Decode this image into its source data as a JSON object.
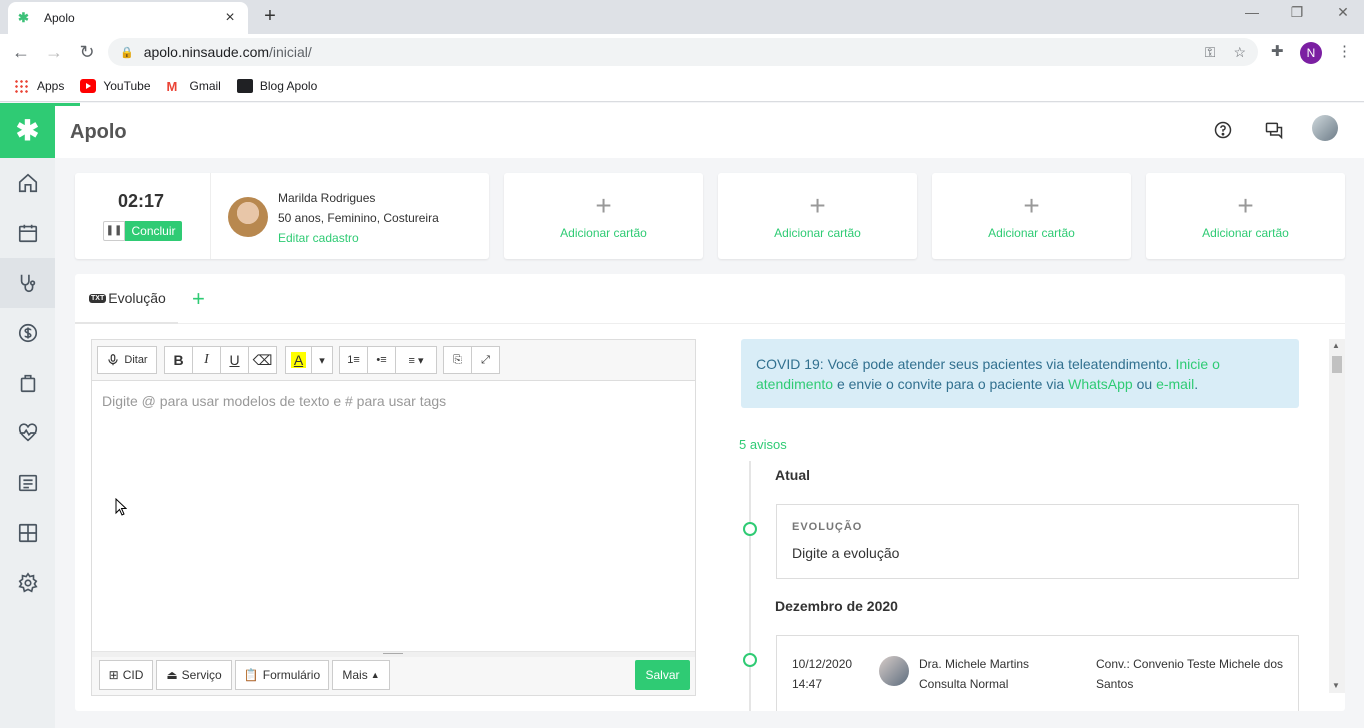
{
  "browser": {
    "tab_title": "Apolo",
    "url_host": "apolo.ninsaude.com",
    "url_path": "/inicial/",
    "profile_initial": "N",
    "bookmarks": [
      "Apps",
      "YouTube",
      "Gmail",
      "Blog Apolo"
    ]
  },
  "app": {
    "title": "Apolo",
    "accent_color": "#2fcb74"
  },
  "consult": {
    "timer": "02:17",
    "conclude_label": "Concluir",
    "pause_icon": "pause-icon"
  },
  "patient": {
    "name": "Marilda Rodrigues",
    "info": "50 anos, Feminino, Costureira",
    "edit_link": "Editar cadastro"
  },
  "add_cards": [
    "Adicionar cartão",
    "Adicionar cartão",
    "Adicionar cartão",
    "Adicionar cartão"
  ],
  "tabs": {
    "evolution": "Evolução"
  },
  "editor": {
    "dictate_label": "Ditar",
    "placeholder": "Digite @ para usar modelos de texto e # para usar tags",
    "footer": {
      "cid": "CID",
      "service": "Serviço",
      "form": "Formulário",
      "more": "Mais",
      "save": "Salvar"
    }
  },
  "notice": {
    "text1": "COVID 19: Você pode atender seus pacientes via teleatendimento.",
    "link1": "Inicie o atendimento",
    "text2": "e envie o convite para o paciente via",
    "link2": "WhatsApp",
    "text3": "ou",
    "link3": "e-mail",
    "text4": "."
  },
  "timeline": {
    "alerts": "5 avisos",
    "current_heading": "Atual",
    "evolution_label": "EVOLUÇÃO",
    "evolution_text": "Digite a evolução",
    "month_heading": "Dezembro de 2020",
    "record": {
      "date": "10/12/2020",
      "time": "14:47",
      "doctor": "Dra. Michele Martins",
      "type": "Consulta Normal",
      "insurance": "Conv.: Convenio Teste Michele dos Santos"
    }
  }
}
